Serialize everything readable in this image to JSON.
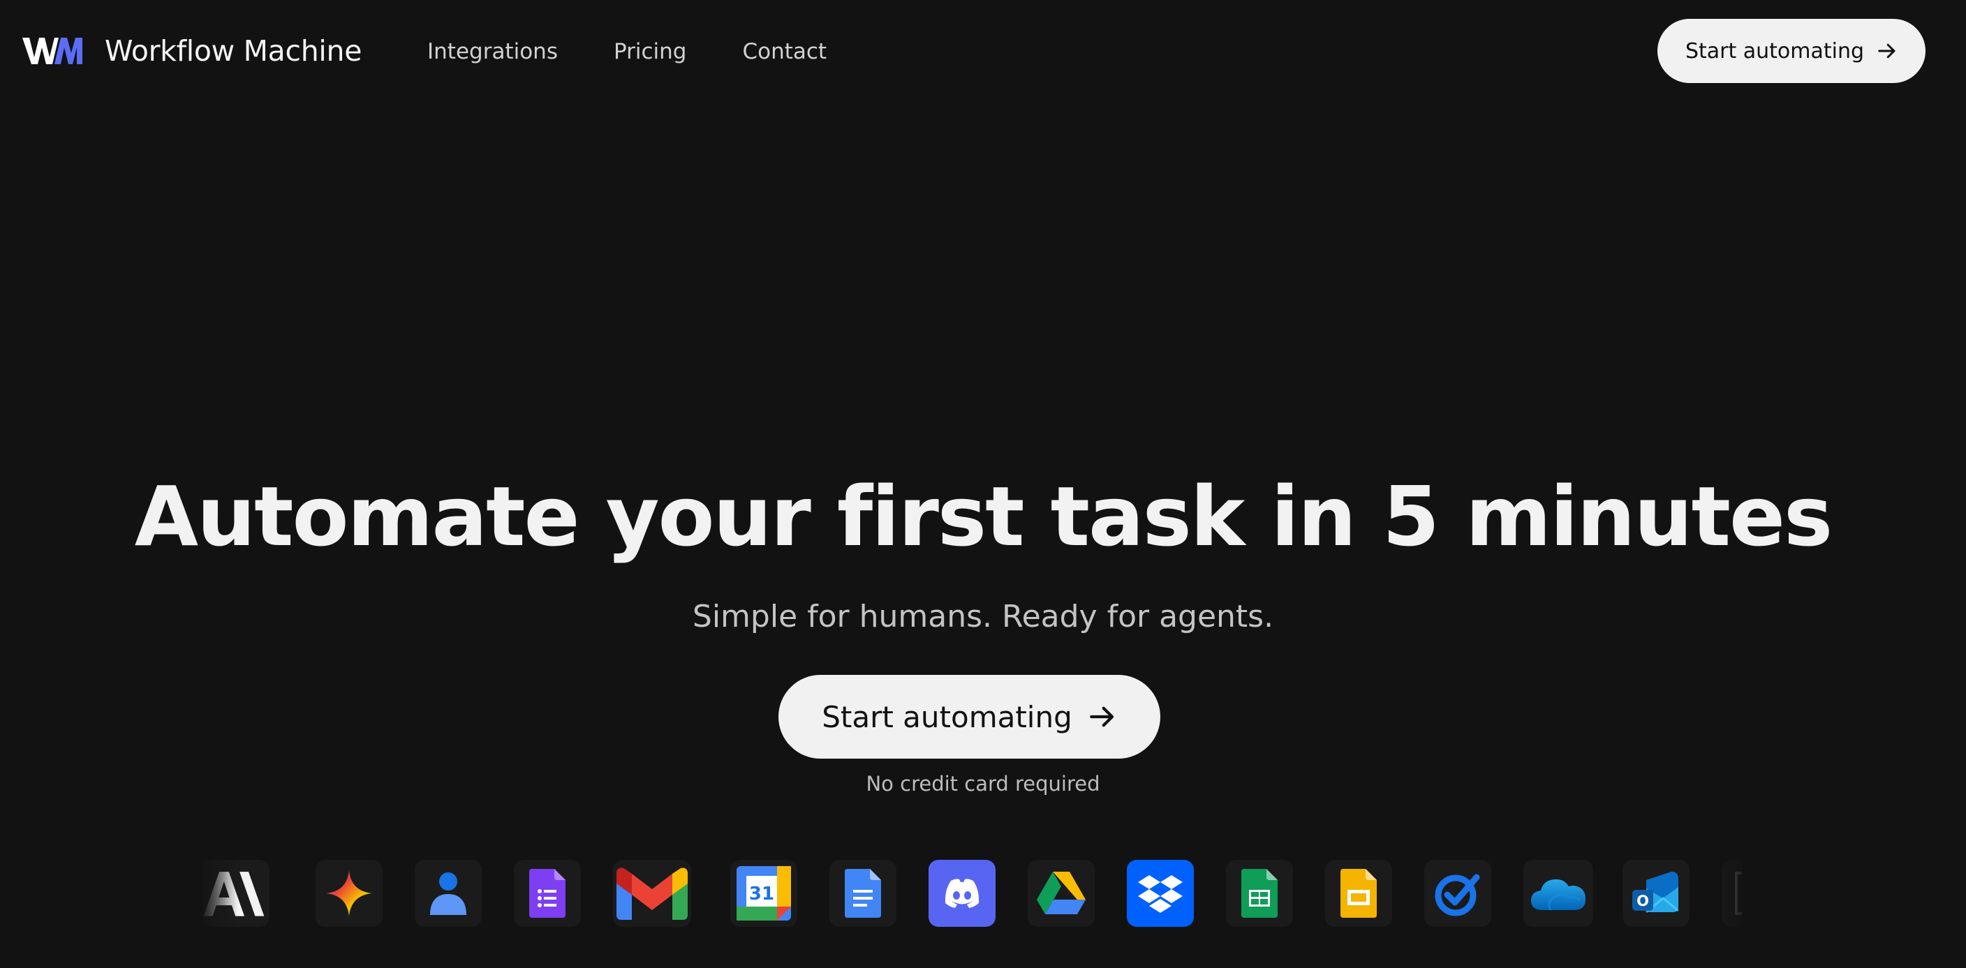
{
  "brand": {
    "logo_text": "WM",
    "name": "Workflow Machine"
  },
  "nav": {
    "links": [
      {
        "label": "Integrations"
      },
      {
        "label": "Pricing"
      },
      {
        "label": "Contact"
      }
    ],
    "cta_label": "Start automating"
  },
  "hero": {
    "title": "Automate your first task in 5 minutes",
    "subtitle": "Simple for humans. Ready for agents.",
    "cta_label": "Start automating",
    "note": "No credit card required"
  },
  "integrations": [
    {
      "icon": "anthropic-icon"
    },
    {
      "icon": "gemini-icon"
    },
    {
      "icon": "google-contacts-icon"
    },
    {
      "icon": "google-forms-icon"
    },
    {
      "icon": "gmail-icon"
    },
    {
      "icon": "google-calendar-icon",
      "text": "31"
    },
    {
      "icon": "google-docs-icon"
    },
    {
      "icon": "discord-icon"
    },
    {
      "icon": "google-drive-icon"
    },
    {
      "icon": "dropbox-icon"
    },
    {
      "icon": "google-sheets-icon"
    },
    {
      "icon": "google-slides-icon"
    },
    {
      "icon": "google-tasks-icon"
    },
    {
      "icon": "onedrive-icon"
    },
    {
      "icon": "outlook-icon",
      "text": "O"
    },
    {
      "icon": "notion-icon"
    }
  ],
  "colors": {
    "background": "#121212",
    "button_bg": "#f1f1f1",
    "brand_accent": "#5b6cf5"
  }
}
